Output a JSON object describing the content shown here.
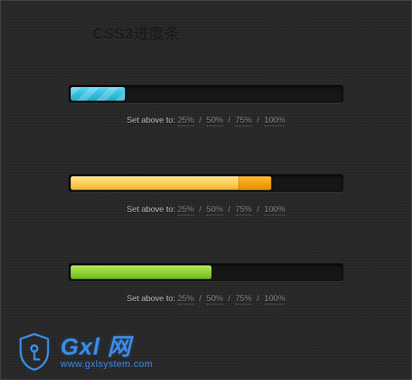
{
  "title": "CSS3进度条",
  "bars": [
    {
      "color": "cyan",
      "percent": 20,
      "hasTrail": false
    },
    {
      "color": "yellow",
      "percent": 74,
      "hasTrail": true
    },
    {
      "color": "green",
      "percent": 52,
      "hasTrail": false
    }
  ],
  "controls": {
    "label": "Set above to:",
    "options": [
      "25%",
      "50%",
      "75%",
      "100%"
    ],
    "separator": "/"
  },
  "layout": {
    "barTops": [
      124,
      254,
      384
    ],
    "controlsOffset": 44
  },
  "watermark": {
    "brand": "Gxl 网",
    "url": "www.gxlsystem.com",
    "color": "#3a8ee8"
  },
  "chart_data": {
    "type": "bar",
    "title": "CSS3进度条",
    "categories": [
      "cyan",
      "yellow",
      "green"
    ],
    "values": [
      20,
      74,
      52
    ],
    "xlabel": "",
    "ylabel": "percent",
    "ylim": [
      0,
      100
    ]
  }
}
